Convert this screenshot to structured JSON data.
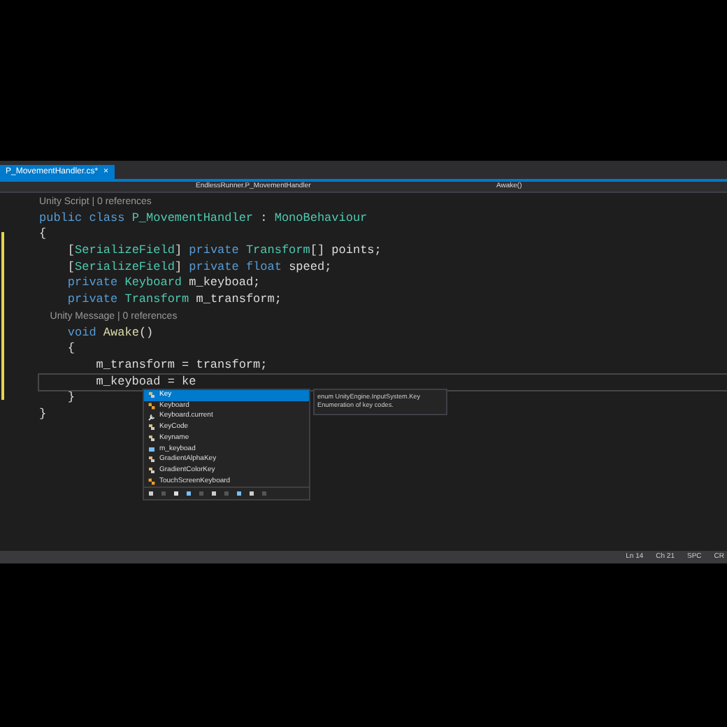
{
  "tabs": [
    {
      "label": "P_MovementHandler.cs*",
      "close_glyph": "×",
      "selected": true
    }
  ],
  "nav_bar": {
    "type_path": "EndlessRunner.P_MovementHandler",
    "member": "Awake()"
  },
  "code_lines": [
    {
      "kind": "lens",
      "current": false,
      "tokens": [
        {
          "t": "Unity Script | 0 references",
          "kind": "lens"
        }
      ]
    },
    {
      "kind": "code",
      "current": false,
      "tokens": [
        {
          "t": "public class ",
          "kind": "kw"
        },
        {
          "t": "P_MovementHandler",
          "kind": "type"
        },
        {
          "t": " : ",
          "kind": "plain"
        },
        {
          "t": "MonoBehaviour",
          "kind": "type"
        }
      ]
    },
    {
      "kind": "code",
      "current": false,
      "tokens": [
        {
          "t": "{",
          "kind": "plain"
        }
      ]
    },
    {
      "kind": "code",
      "current": false,
      "tokens": [
        {
          "t": "    [",
          "kind": "plain"
        },
        {
          "t": "SerializeField",
          "kind": "type"
        },
        {
          "t": "] ",
          "kind": "plain"
        },
        {
          "t": "private ",
          "kind": "kw"
        },
        {
          "t": "Transform",
          "kind": "type"
        },
        {
          "t": "[] points;",
          "kind": "plain"
        }
      ]
    },
    {
      "kind": "code",
      "current": false,
      "tokens": [
        {
          "t": "    [",
          "kind": "plain"
        },
        {
          "t": "SerializeField",
          "kind": "type"
        },
        {
          "t": "] ",
          "kind": "plain"
        },
        {
          "t": "private float ",
          "kind": "kw"
        },
        {
          "t": "speed;",
          "kind": "plain"
        }
      ]
    },
    {
      "kind": "code",
      "current": false,
      "tokens": [
        {
          "t": "    private ",
          "kind": "kw"
        },
        {
          "t": "Keyboard",
          "kind": "type"
        },
        {
          "t": " m_keyboad;",
          "kind": "plain"
        }
      ]
    },
    {
      "kind": "code",
      "current": false,
      "tokens": [
        {
          "t": "    private ",
          "kind": "kw"
        },
        {
          "t": "Transform",
          "kind": "type"
        },
        {
          "t": " m_transform;",
          "kind": "plain"
        }
      ]
    },
    {
      "kind": "lens",
      "current": false,
      "tokens": [
        {
          "t": "    Unity Message | 0 references",
          "kind": "lens"
        }
      ]
    },
    {
      "kind": "code",
      "current": false,
      "tokens": [
        {
          "t": "    void ",
          "kind": "kw"
        },
        {
          "t": "Awake",
          "kind": "method"
        },
        {
          "t": "()",
          "kind": "plain"
        }
      ]
    },
    {
      "kind": "code",
      "current": false,
      "tokens": [
        {
          "t": "    {",
          "kind": "plain"
        }
      ]
    },
    {
      "kind": "code",
      "current": false,
      "tokens": [
        {
          "t": "        m_transform = transform;",
          "kind": "plain"
        }
      ]
    },
    {
      "kind": "code",
      "current": true,
      "tokens": [
        {
          "t": "        m_keyboad = ke",
          "kind": "plain"
        }
      ]
    },
    {
      "kind": "code",
      "current": false,
      "tokens": [
        {
          "t": "    }",
          "kind": "plain"
        }
      ]
    },
    {
      "kind": "code",
      "current": false,
      "tokens": [
        {
          "t": "}",
          "kind": "plain"
        }
      ]
    }
  ],
  "completion": {
    "items": [
      {
        "label": "Key",
        "kind": "enum",
        "selected": true
      },
      {
        "label": "Keyboard",
        "kind": "class",
        "selected": false
      },
      {
        "label": "Keyboard.current",
        "kind": "property",
        "selected": false
      },
      {
        "label": "KeyCode",
        "kind": "enum",
        "selected": false
      },
      {
        "label": "Keyname",
        "kind": "enum",
        "selected": false
      },
      {
        "label": "m_keyboad",
        "kind": "field",
        "selected": false
      },
      {
        "label": "GradientAlphaKey",
        "kind": "enum",
        "selected": false
      },
      {
        "label": "GradientColorKey",
        "kind": "enum",
        "selected": false
      },
      {
        "label": "TouchScreenKeyboard",
        "kind": "class",
        "selected": false
      }
    ],
    "tooltip_signature": "enum UnityEngine.InputSystem.Key",
    "tooltip_description": "Enumeration of key codes."
  },
  "status_bar": {
    "items": [
      "Ln 14",
      "Ch 21",
      "SPC",
      "CR"
    ]
  }
}
